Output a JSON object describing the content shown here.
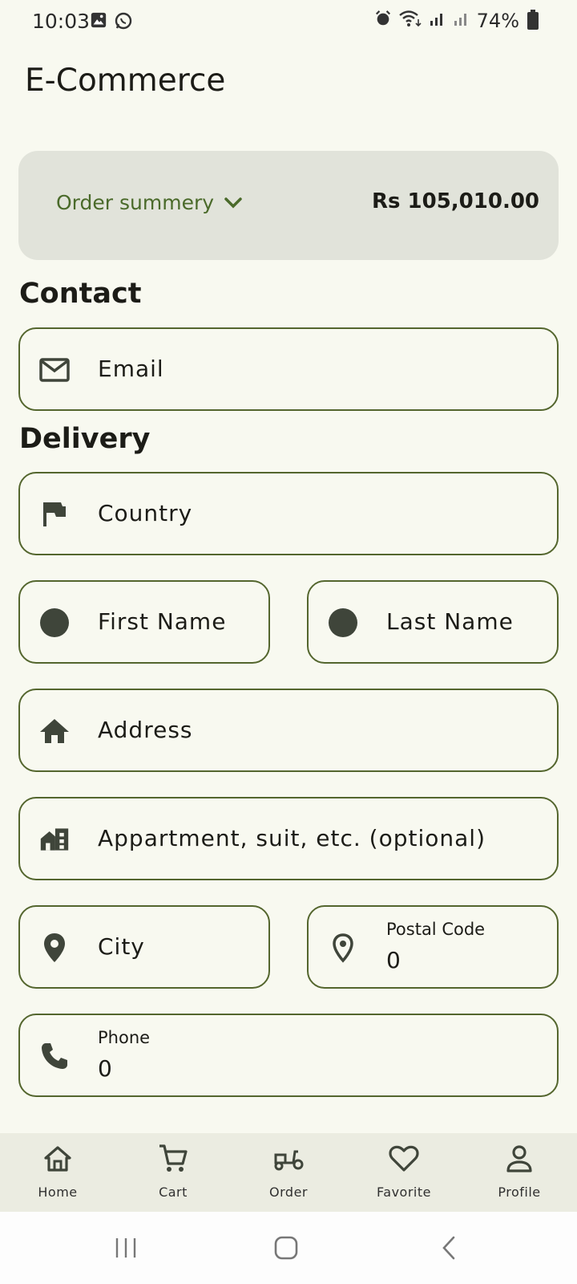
{
  "status_bar": {
    "time": "10:03",
    "battery": "74%"
  },
  "app": {
    "title": "E-Commerce"
  },
  "order_summary": {
    "label": "Order summery",
    "total": "Rs 105,010.00"
  },
  "sections": {
    "contact": "Contact",
    "delivery": "Delivery"
  },
  "fields": {
    "email": {
      "placeholder": "Email"
    },
    "country": {
      "placeholder": "Country"
    },
    "first_name": {
      "placeholder": "First Name"
    },
    "last_name": {
      "placeholder": "Last Name"
    },
    "address": {
      "placeholder": "Address"
    },
    "apartment": {
      "placeholder": "Appartment, suit, etc. (optional)"
    },
    "city": {
      "placeholder": "City"
    },
    "postal_code": {
      "label": "Postal Code",
      "value": "0"
    },
    "phone": {
      "label": "Phone",
      "value": "0"
    }
  },
  "bottom_nav": [
    {
      "label": "Home",
      "icon": "home-icon"
    },
    {
      "label": "Cart",
      "icon": "cart-icon"
    },
    {
      "label": "Order",
      "icon": "scooter-icon"
    },
    {
      "label": "Favorite",
      "icon": "heart-icon"
    },
    {
      "label": "Profile",
      "icon": "person-icon"
    }
  ],
  "colors": {
    "accent": "#4a6a2a",
    "border": "#54662e",
    "background": "#f8f9f0",
    "card": "#e1e3da",
    "icon": "#3f453a"
  }
}
